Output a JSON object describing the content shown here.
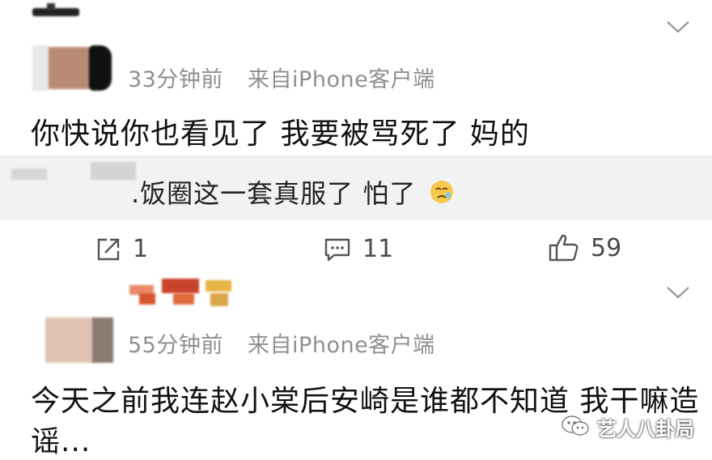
{
  "comment1": {
    "time": "33分钟前",
    "source": "来自iPhone客户端",
    "text": "你快说你也看见了 我要被骂死了 妈的",
    "reply_text": ".饭圈这一套真服了 怕了",
    "reply_emoji": "sad-face-emoji"
  },
  "actions": {
    "share_count": "1",
    "comment_count": "11",
    "like_count": "59"
  },
  "comment2": {
    "time": "55分钟前",
    "source": "来自iPhone客户端",
    "text_line1": "今天之前我连赵小棠后安崎是谁都不知道 我干嘛造",
    "text_line2": "谣..."
  },
  "watermark": {
    "text": "艺人八卦局"
  },
  "colors": {
    "meta_gray": "#8f8f8f",
    "quote_bg": "#f2f2f2",
    "icon_gray": "#555555"
  }
}
